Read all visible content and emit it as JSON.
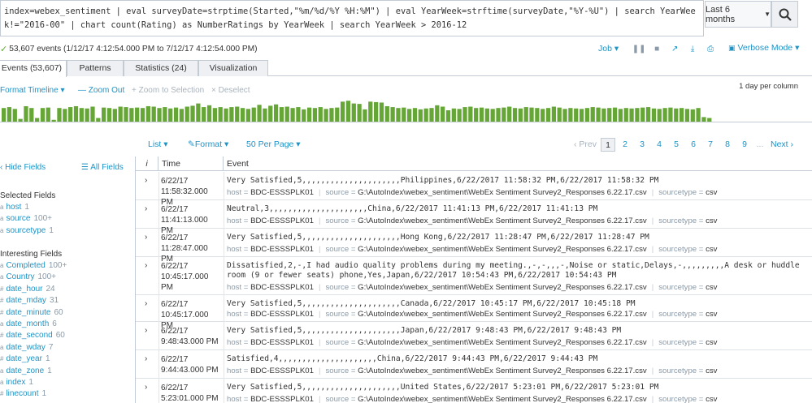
{
  "search": {
    "query": "index=webex_sentiment | eval surveyDate=strptime(Started,\"%m/%d/%Y %H:%M\") | eval YearWeek=strftime(surveyDate,\"%Y-%U\") | search YearWeek!=\"2016-00\" | chart count(Rating) as NumberRatings by YearWeek | search YearWeek > 2016-12",
    "time_range": "Last 6 months"
  },
  "status": {
    "summary": "53,607 events (1/12/17 4:12:54.000 PM to 7/12/17 4:12:54.000 PM)",
    "job_label": "Job",
    "mode": "Verbose Mode"
  },
  "tabs": [
    {
      "label": "Events (53,607)",
      "active": true
    },
    {
      "label": "Patterns",
      "active": false
    },
    {
      "label": "Statistics (24)",
      "active": false
    },
    {
      "label": "Visualization",
      "active": false
    }
  ],
  "timeline": {
    "format_label": "Format Timeline",
    "zoom_out": "Zoom Out",
    "zoom_selection": "Zoom to Selection",
    "deselect": "Deselect",
    "scale": "1 day per column",
    "bar_color": "#65a637",
    "values": [
      30,
      32,
      28,
      6,
      34,
      30,
      8,
      30,
      31,
      4,
      30,
      28,
      32,
      34,
      30,
      29,
      33,
      8,
      31,
      30,
      28,
      33,
      32,
      30,
      31,
      30,
      34,
      33,
      30,
      32,
      29,
      31,
      28,
      33,
      35,
      40,
      32,
      36,
      30,
      32,
      29,
      32,
      33,
      30,
      28,
      31,
      37,
      29,
      35,
      38,
      32,
      33,
      30,
      32,
      27,
      31,
      30,
      32,
      28,
      30,
      31,
      44,
      46,
      40,
      39,
      27,
      44,
      43,
      42,
      34,
      32,
      30,
      31,
      28,
      30,
      27,
      29,
      30,
      36,
      33,
      25,
      29,
      28,
      32,
      33,
      30,
      31,
      29,
      28,
      30,
      31,
      33,
      30,
      29,
      32,
      31,
      30,
      28,
      30,
      33,
      31,
      28,
      30,
      29,
      28,
      30,
      32,
      31,
      29,
      30,
      31,
      28,
      30,
      29,
      30,
      31,
      32,
      29,
      28,
      30,
      31,
      29,
      30,
      28,
      27,
      30,
      10,
      8
    ]
  },
  "list_controls": {
    "list_label": "List",
    "format_label": "Format",
    "per_page_label": "50 Per Page",
    "prev": "‹ Prev",
    "pages": [
      "1",
      "2",
      "3",
      "4",
      "5",
      "6",
      "7",
      "8",
      "9"
    ],
    "ellipsis": "...",
    "next": "Next ›"
  },
  "sidebar": {
    "hide_fields": "Hide Fields",
    "all_fields": "All Fields",
    "selected_heading": "Selected Fields",
    "selected": [
      {
        "type": "a",
        "name": "host",
        "count": "1"
      },
      {
        "type": "a",
        "name": "source",
        "count": "100+"
      },
      {
        "type": "a",
        "name": "sourcetype",
        "count": "1"
      }
    ],
    "interesting_heading": "Interesting Fields",
    "interesting": [
      {
        "type": "a",
        "name": "Completed",
        "count": "100+"
      },
      {
        "type": "a",
        "name": "Country",
        "count": "100+"
      },
      {
        "type": "#",
        "name": "date_hour",
        "count": "24"
      },
      {
        "type": "#",
        "name": "date_mday",
        "count": "31"
      },
      {
        "type": "#",
        "name": "date_minute",
        "count": "60"
      },
      {
        "type": "a",
        "name": "date_month",
        "count": "6"
      },
      {
        "type": "#",
        "name": "date_second",
        "count": "60"
      },
      {
        "type": "a",
        "name": "date_wday",
        "count": "7"
      },
      {
        "type": "#",
        "name": "date_year",
        "count": "1"
      },
      {
        "type": "a",
        "name": "date_zone",
        "count": "1"
      },
      {
        "type": "a",
        "name": "index",
        "count": "1"
      },
      {
        "type": "#",
        "name": "linecount",
        "count": "1"
      }
    ]
  },
  "events": {
    "headers": {
      "info": "i",
      "time": "Time",
      "event": "Event"
    },
    "meta_keys": {
      "host": "host =",
      "source": "source =",
      "sourcetype": "sourcetype ="
    },
    "rows": [
      {
        "date": "6/22/17",
        "time": "11:58:32.000 PM",
        "raw": "Very Satisfied,5,,,,,,,,,,,,,,,,,,,,,Philippines,6/22/2017 11:58:32 PM,6/22/2017 11:58:32 PM",
        "host": "BDC-ESSSPLK01",
        "source": "G:\\AutoIndex\\webex_sentiment\\WebEx Sentiment Survey2_Responses 6.22.17.csv",
        "sourcetype": "csv"
      },
      {
        "date": "6/22/17",
        "time": "11:41:13.000 PM",
        "raw": "Neutral,3,,,,,,,,,,,,,,,,,,,,,China,6/22/2017 11:41:13 PM,6/22/2017 11:41:13 PM",
        "host": "BDC-ESSSPLK01",
        "source": "G:\\AutoIndex\\webex_sentiment\\WebEx Sentiment Survey2_Responses 6.22.17.csv",
        "sourcetype": "csv"
      },
      {
        "date": "6/22/17",
        "time": "11:28:47.000 PM",
        "raw": "Very Satisfied,5,,,,,,,,,,,,,,,,,,,,,Hong Kong,6/22/2017 11:28:47 PM,6/22/2017 11:28:47 PM",
        "host": "BDC-ESSSPLK01",
        "source": "G:\\AutoIndex\\webex_sentiment\\WebEx Sentiment Survey2_Responses 6.22.17.csv",
        "sourcetype": "csv"
      },
      {
        "date": "6/22/17",
        "time": "10:45:17.000 PM",
        "raw": "Dissatisfied,2,-,I had audio quality problems during my meeting.,-,-,,,-,Noise or static,Delays,-,,,,,,,,,A desk or huddle room (9 or fewer seats) phone,Yes,Japan,6/22/2017 10:54:43 PM,6/22/2017 10:54:43 PM",
        "host": "BDC-ESSSPLK01",
        "source": "G:\\AutoIndex\\webex_sentiment\\WebEx Sentiment Survey2_Responses 6.22.17.csv",
        "sourcetype": "csv"
      },
      {
        "date": "6/22/17",
        "time": "10:45:17.000 PM",
        "raw": "Very Satisfied,5,,,,,,,,,,,,,,,,,,,,,Canada,6/22/2017 10:45:17 PM,6/22/2017 10:45:18 PM",
        "host": "BDC-ESSSPLK01",
        "source": "G:\\AutoIndex\\webex_sentiment\\WebEx Sentiment Survey2_Responses 6.22.17.csv",
        "sourcetype": "csv"
      },
      {
        "date": "6/22/17",
        "time": "9:48:43.000 PM",
        "raw": "Very Satisfied,5,,,,,,,,,,,,,,,,,,,,,Japan,6/22/2017 9:48:43 PM,6/22/2017 9:48:43 PM",
        "host": "BDC-ESSSPLK01",
        "source": "G:\\AutoIndex\\webex_sentiment\\WebEx Sentiment Survey2_Responses 6.22.17.csv",
        "sourcetype": "csv"
      },
      {
        "date": "6/22/17",
        "time": "9:44:43.000 PM",
        "raw": "Satisfied,4,,,,,,,,,,,,,,,,,,,,,China,6/22/2017 9:44:43 PM,6/22/2017 9:44:43 PM",
        "host": "BDC-ESSSPLK01",
        "source": "G:\\AutoIndex\\webex_sentiment\\WebEx Sentiment Survey2_Responses 6.22.17.csv",
        "sourcetype": "csv"
      },
      {
        "date": "6/22/17",
        "time": "5:23:01.000 PM",
        "raw": "Very Satisfied,5,,,,,,,,,,,,,,,,,,,,,United States,6/22/2017 5:23:01 PM,6/22/2017 5:23:01 PM",
        "host": "BDC-ESSSPLK01",
        "source": "G:\\AutoIndex\\webex_sentiment\\WebEx Sentiment Survey2_Responses 6.22.17.csv",
        "sourcetype": "csv"
      }
    ]
  }
}
